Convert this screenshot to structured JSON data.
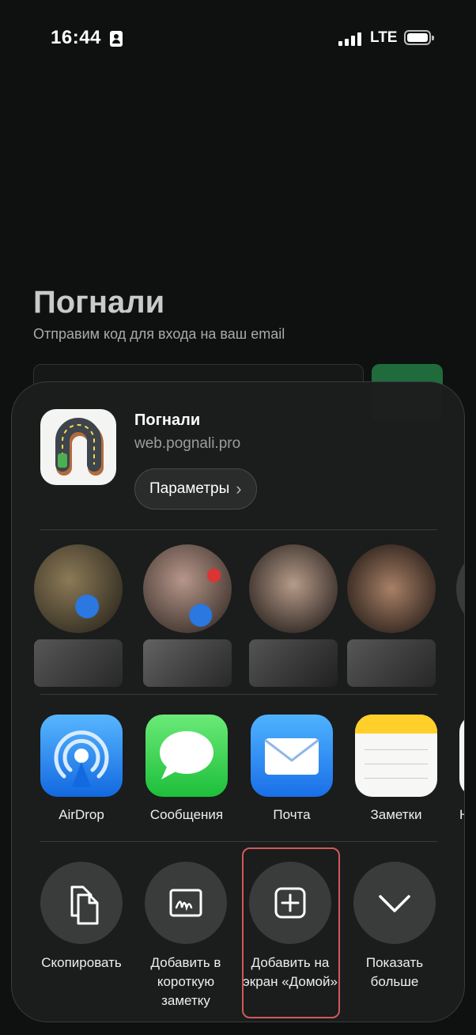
{
  "status_bar": {
    "time": "16:44",
    "network": "LTE"
  },
  "background_page": {
    "title": "Погнали",
    "subtitle": "Отправим код для входа на ваш email"
  },
  "share_sheet": {
    "app": {
      "name": "Погнали",
      "url": "web.pognali.pro",
      "options_label": "Параметры"
    },
    "apps": [
      {
        "label": "AirDrop",
        "icon": "airdrop-icon"
      },
      {
        "label": "Сообщения",
        "icon": "messages-icon"
      },
      {
        "label": "Почта",
        "icon": "mail-icon"
      },
      {
        "label": "Заметки",
        "icon": "notes-icon"
      },
      {
        "label": "На",
        "icon": "partial-app-icon"
      }
    ],
    "actions": [
      {
        "label": "Скопировать",
        "icon": "copy-icon"
      },
      {
        "label": "Добавить в короткую заметку",
        "icon": "quick-note-icon"
      },
      {
        "label": "Добавить на экран «Домой»",
        "icon": "add-square-icon"
      },
      {
        "label": "Показать больше",
        "icon": "chevron-down-icon"
      }
    ]
  },
  "colors": {
    "accent_green": "#1f6b3c",
    "highlight_red": "#d05a5a",
    "sheet_bg": "#1c1d1d"
  }
}
